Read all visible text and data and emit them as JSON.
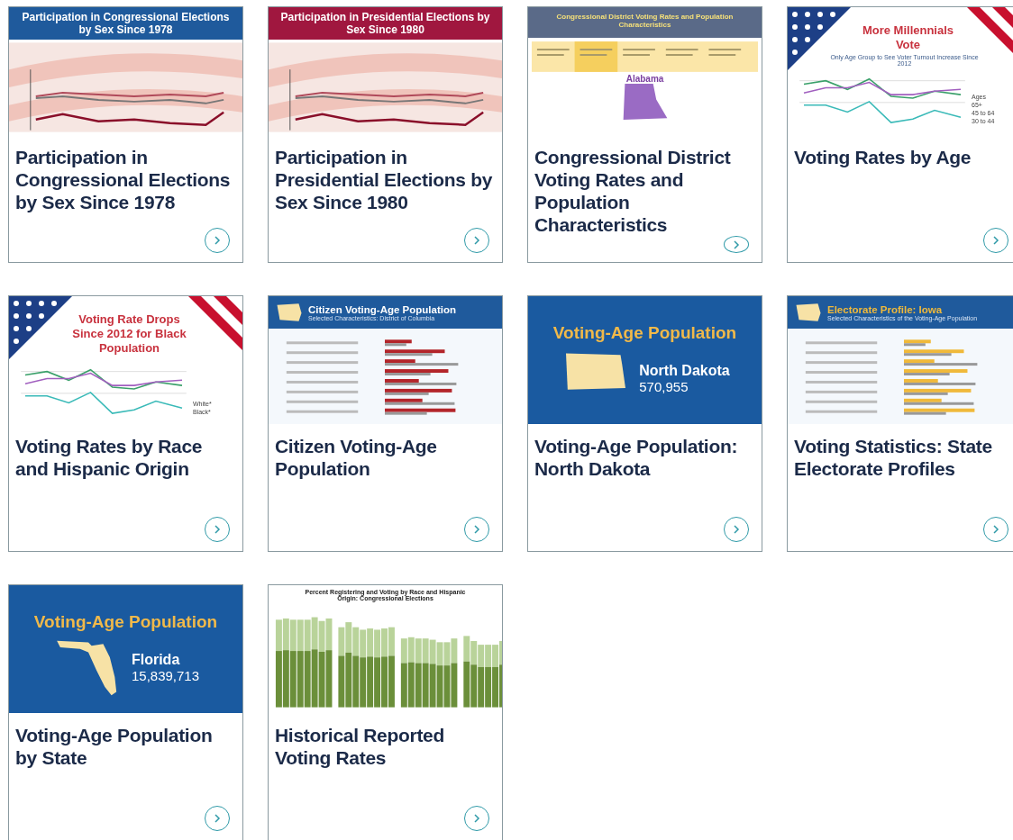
{
  "cards": [
    {
      "title": "Participation in Congressional Elections by Sex Since 1978",
      "thumb": {
        "kind": "banner",
        "color": "#1f5a9c",
        "heading": "Participation in Congressional Elections by Sex Since 1978"
      }
    },
    {
      "title": "Participation in Presidential Elections by Sex Since 1980",
      "thumb": {
        "kind": "banner",
        "color": "#a0173f",
        "heading": "Participation in Presidential Elections by Sex Since 1980"
      }
    },
    {
      "title": "Congressional District Voting Rates and Population Characteristics",
      "thumb": {
        "kind": "dashboard",
        "heading": "Congressional District Voting Rates and Population Characteristics",
        "place": "Alabama"
      }
    },
    {
      "title": "Voting Rates by Age",
      "thumb": {
        "kind": "flag",
        "heading": "More Millennials Vote",
        "subheading": "Only Age Group to See Voter Turnout Increase Since 2012",
        "labels": [
          "Ages",
          "65+",
          "45 to 64",
          "30 to 44"
        ]
      }
    },
    {
      "title": "Voting Rates by Race and Hispanic Origin",
      "thumb": {
        "kind": "flag",
        "heading": "Voting Rate Drops Since 2012 for Black Population",
        "labels": [
          "White*",
          "Black*"
        ]
      }
    },
    {
      "title": "Citizen Voting-Age Population",
      "thumb": {
        "kind": "profile",
        "color": "#ffffff",
        "heading": "Citizen Voting-Age Population",
        "subheading": "Selected Characteristics: District of Columbia"
      }
    },
    {
      "title": "Voting-Age Population: North Dakota",
      "thumb": {
        "kind": "blockstate",
        "heading": "Voting-Age Population",
        "state": "North Dakota",
        "number": "570,955"
      }
    },
    {
      "title": "Voting Statistics: State Electorate Profiles",
      "thumb": {
        "kind": "profile",
        "color": "#f0b93a",
        "heading": "Electorate Profile: Iowa",
        "subheading": "Selected Characteristics of the Voting-Age Population"
      }
    },
    {
      "title": "Voting-Age Population by State",
      "thumb": {
        "kind": "peninsulastate",
        "heading": "Voting-Age Population",
        "state": "Florida",
        "number": "15,839,713"
      }
    },
    {
      "title": "Historical Reported Voting Rates",
      "thumb": {
        "kind": "bars",
        "heading": "Percent Registering and Voting by Race and Hispanic Origin: Congressional Elections"
      }
    }
  ]
}
